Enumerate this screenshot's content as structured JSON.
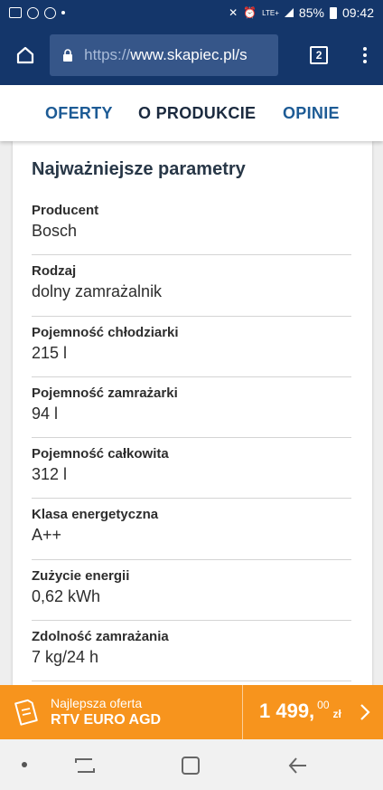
{
  "status_bar": {
    "battery": "85%",
    "time": "09:42",
    "network": "LTE+"
  },
  "browser": {
    "url_protocol": "https://",
    "url_host": "www.skapiec.pl/s",
    "tab_count": "2"
  },
  "tabs": [
    {
      "label": "OFERTY"
    },
    {
      "label": "O PRODUKCIE"
    },
    {
      "label": "OPINIE"
    }
  ],
  "card": {
    "title": "Najważniejsze parametry",
    "params": [
      {
        "label": "Producent",
        "value": "Bosch"
      },
      {
        "label": "Rodzaj",
        "value": "dolny zamrażalnik"
      },
      {
        "label": "Pojemność chłodziarki",
        "value": "215 l"
      },
      {
        "label": "Pojemność zamrażarki",
        "value": "94 l"
      },
      {
        "label": "Pojemność całkowita",
        "value": "312 l"
      },
      {
        "label": "Klasa energetyczna",
        "value": "A++"
      },
      {
        "label": "Zużycie energii",
        "value": "0,62 kWh"
      },
      {
        "label": "Zdolność zamrażania",
        "value": "7 kg/24 h"
      }
    ]
  },
  "offer": {
    "label": "Najlepsza oferta",
    "shop": "RTV EURO AGD",
    "price_main": "1 499,",
    "price_cents": "00",
    "currency": "zł"
  },
  "colors": {
    "header_bg": "#14366a",
    "accent_link": "#1d5b95",
    "offer_bg": "#f7941d"
  }
}
